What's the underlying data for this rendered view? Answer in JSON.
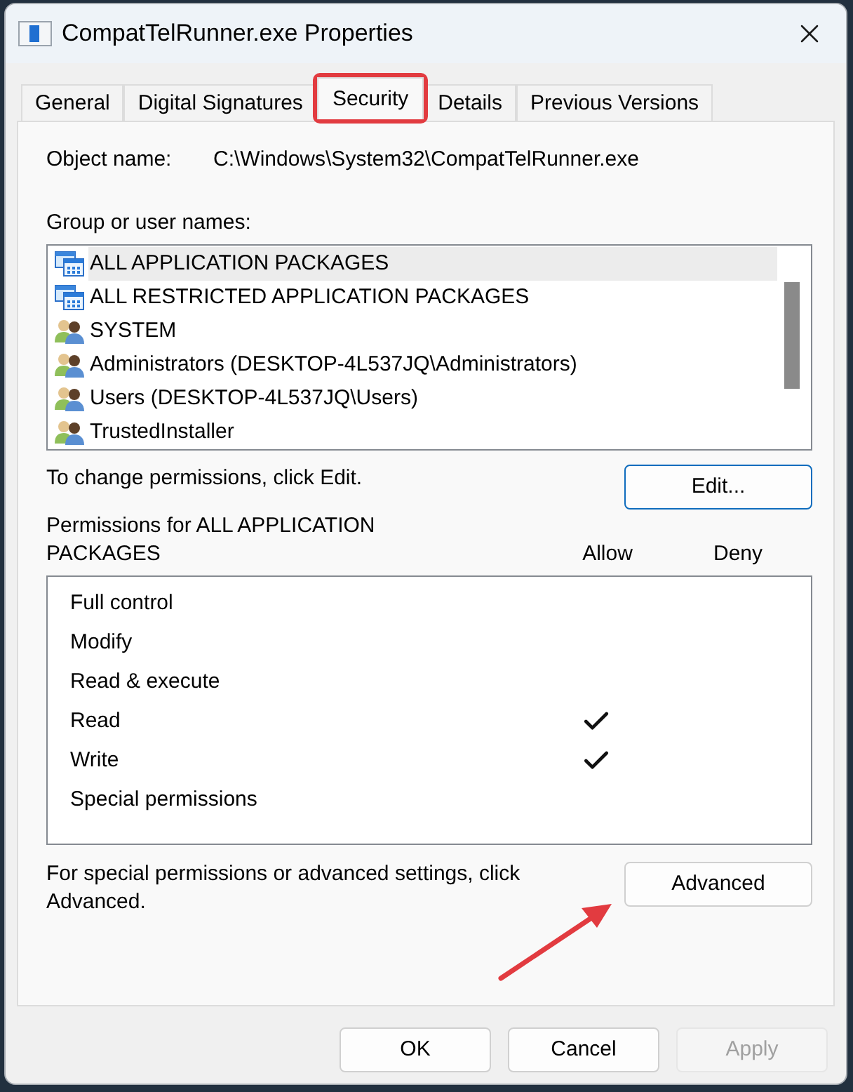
{
  "window": {
    "title": "CompatTelRunner.exe Properties"
  },
  "tabs": [
    {
      "label": "General",
      "selected": false,
      "highlighted": false
    },
    {
      "label": "Digital Signatures",
      "selected": false,
      "highlighted": false
    },
    {
      "label": "Security",
      "selected": true,
      "highlighted": true
    },
    {
      "label": "Details",
      "selected": false,
      "highlighted": false
    },
    {
      "label": "Previous Versions",
      "selected": false,
      "highlighted": false
    }
  ],
  "object_name": {
    "label": "Object name:",
    "value": "C:\\Windows\\System32\\CompatTelRunner.exe"
  },
  "group_list": {
    "label": "Group or user names:",
    "items": [
      {
        "name": "ALL APPLICATION PACKAGES",
        "kind": "package",
        "selected": true
      },
      {
        "name": "ALL RESTRICTED APPLICATION PACKAGES",
        "kind": "package",
        "selected": false
      },
      {
        "name": "SYSTEM",
        "kind": "user",
        "selected": false
      },
      {
        "name": "Administrators (DESKTOP-4L537JQ\\Administrators)",
        "kind": "user",
        "selected": false
      },
      {
        "name": "Users (DESKTOP-4L537JQ\\Users)",
        "kind": "user",
        "selected": false
      },
      {
        "name": "TrustedInstaller",
        "kind": "user",
        "selected": false
      }
    ]
  },
  "edit_hint": "To change permissions, click Edit.",
  "edit_button": {
    "label": "Edit...",
    "focused": true
  },
  "permissions": {
    "title": "Permissions for ALL APPLICATION PACKAGES",
    "columns": [
      "Allow",
      "Deny"
    ],
    "rows": [
      {
        "name": "Full control",
        "allow": false,
        "deny": false
      },
      {
        "name": "Modify",
        "allow": false,
        "deny": false
      },
      {
        "name": "Read & execute",
        "allow": false,
        "deny": false
      },
      {
        "name": "Read",
        "allow": true,
        "deny": false
      },
      {
        "name": "Write",
        "allow": true,
        "deny": false
      },
      {
        "name": "Special permissions",
        "allow": false,
        "deny": false
      }
    ]
  },
  "advanced_hint": "For special permissions or advanced settings, click Advanced.",
  "advanced_button": {
    "label": "Advanced",
    "focused": false,
    "annotated": true
  },
  "buttons": [
    {
      "label": "OK",
      "disabled": false
    },
    {
      "label": "Cancel",
      "disabled": false
    },
    {
      "label": "Apply",
      "disabled": true
    }
  ]
}
